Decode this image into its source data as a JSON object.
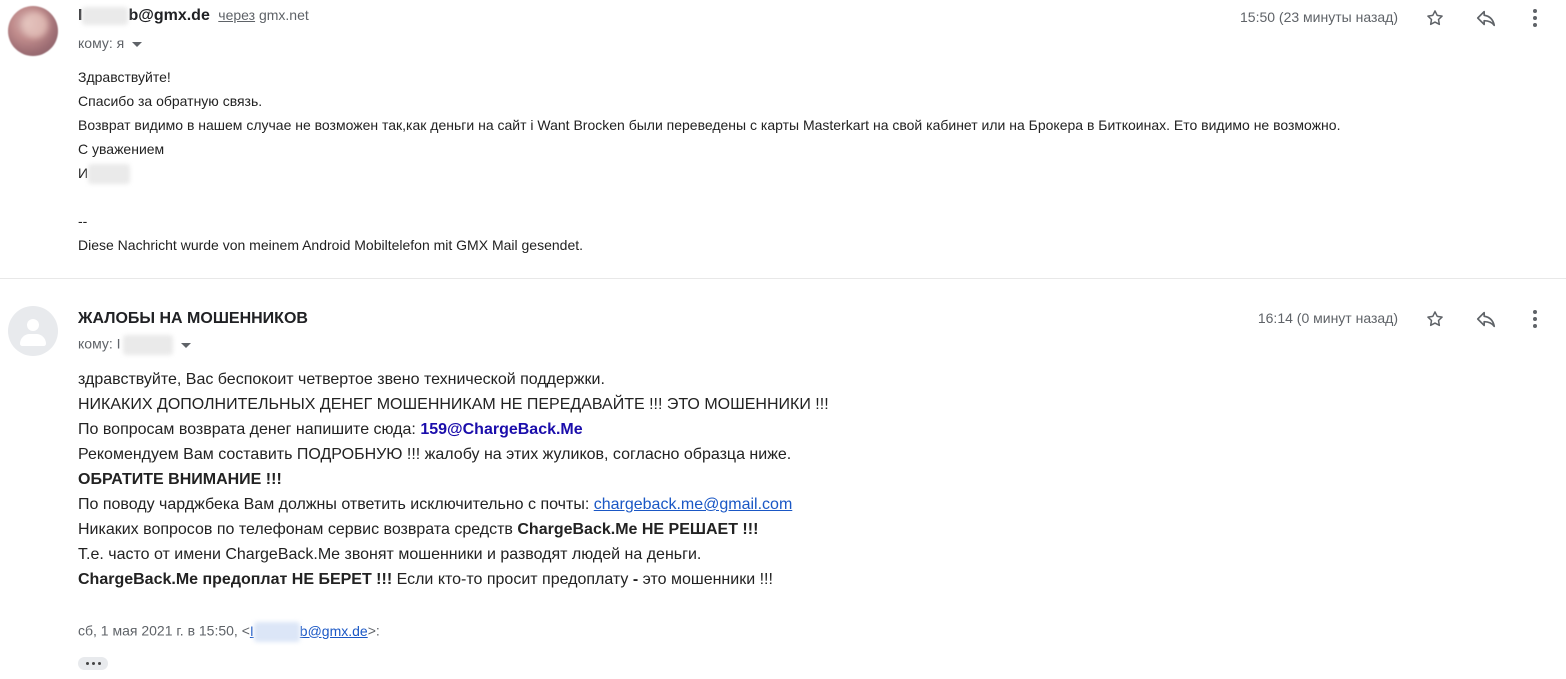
{
  "message1": {
    "sender_prefix": "I",
    "sender_suffix": "b@gmx.de",
    "via_label": "через",
    "via_domain": "gmx.net",
    "to_label": "кому: я",
    "time": "15:50 (23 минуты назад)",
    "body": {
      "greeting": "Здравствуйте!",
      "thanks": "Спасибо за обратную связь.",
      "main": "Возврат видимо в нашем случае не возможен так,как деньги на сайт i Want Brocken были переведены с карты Masterkart на свой кабинет или на Брокера в Биткоинах. Ето видимо не возможно.",
      "regards": "С уважением",
      "signature_initial": "И",
      "separator": "--",
      "footer": "Diese Nachricht wurde von meinem Android Mobiltelefon mit GMX Mail gesendet."
    }
  },
  "message2": {
    "sender": "ЖАЛОБЫ НА МОШЕННИКОВ",
    "to_label": "кому: I",
    "time": "16:14 (0 минут назад)",
    "body": {
      "line1": "здравствуйте, Вас беспокоит четвертое звено технической поддержки.",
      "line2": "НИКАКИХ ДОПОЛНИТЕЛЬНЫХ ДЕНЕГ МОШЕННИКАМ НЕ ПЕРЕДАВАЙТЕ !!! ЭТО МОШЕННИКИ !!!",
      "line3_text": "По вопросам возврата денег напишите сюда: ",
      "line3_email": "159@ChargeBack.Me",
      "line4": "Рекомендуем Вам составить ПОДРОБНУЮ !!! жалобу на этих жуликов, согласно образца ниже.",
      "line5": "ОБРАТИТЕ ВНИМАНИЕ !!!",
      "line6_text": "По поводу чарджбека Вам должны ответить исключительно с почты: ",
      "line6_link": "chargeback.me@gmail.com",
      "line7_text": "Никаких вопросов по телефонам сервис возврата средств ",
      "line7_bold": "ChargeBack.Me НЕ РЕШАЕТ !!!",
      "line8": "Т.е. часто от имени ChargeBack.Me звонят мошенники и разводят людей на деньги.",
      "line9_bold": "ChargeBack.Me предоплат НЕ БЕРЕТ !!!",
      "line9_text": " Если кто-то просит предоплату ",
      "line9_dash": "-",
      "line9_end": " это мошенники !!!"
    },
    "quote_prefix": "сб, 1 мая 2021 г. в 15:50, <",
    "quote_email_start": "I",
    "quote_email_end": "b@gmx.de",
    "quote_suffix": ">:"
  },
  "icons": {
    "star": "star-icon",
    "reply": "reply-icon",
    "more": "more-vert-icon",
    "avatar": "avatar-icon",
    "caret": "caret-down-icon",
    "ellipsis": "show-trimmed-content-icon"
  },
  "colors": {
    "link": "#1a57c5",
    "bold_link": "#1a0dab",
    "muted": "#5f6368"
  }
}
